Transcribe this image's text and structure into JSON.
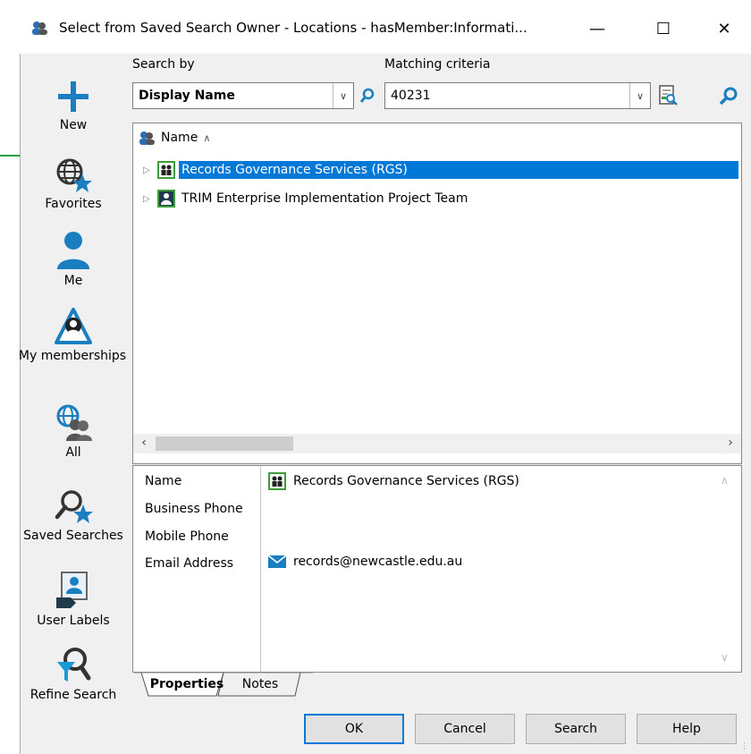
{
  "window": {
    "title": "Select from Saved Search Owner - Locations - hasMember:Informati...",
    "minimize_glyph": "—",
    "maximize_glyph": "☐",
    "close_glyph": "✕"
  },
  "sidebar": {
    "items": [
      {
        "label": "New",
        "icon": "plus-icon"
      },
      {
        "label": "Favorites",
        "icon": "globe-star-icon"
      },
      {
        "label": "Me",
        "icon": "person-icon"
      },
      {
        "label": "My memberships",
        "icon": "membership-icon"
      },
      {
        "label": "All",
        "icon": "globe-people-icon"
      },
      {
        "label": "Saved Searches",
        "icon": "search-star-icon"
      },
      {
        "label": "User Labels",
        "icon": "user-label-icon"
      },
      {
        "label": "Refine Search",
        "icon": "filter-search-icon"
      }
    ]
  },
  "search": {
    "search_by_label": "Search by",
    "search_by_value": "Display Name",
    "matching_label": "Matching criteria",
    "matching_value": "40231"
  },
  "list": {
    "column_header": "Name",
    "sort_glyph": "∧",
    "rows": [
      {
        "name": "Records Governance Services (RGS)",
        "selected": true
      },
      {
        "name": "TRIM Enterprise Implementation Project Team",
        "selected": false
      }
    ]
  },
  "properties": {
    "labels": [
      "Name",
      "Business Phone",
      "Mobile Phone",
      "Email Address"
    ],
    "name_value": "Records Governance Services (RGS)",
    "email_value": "records@newcastle.edu.au"
  },
  "tabs": [
    "Properties",
    "Notes"
  ],
  "buttons": {
    "ok": "OK",
    "cancel": "Cancel",
    "search": "Search",
    "help": "Help"
  },
  "colors": {
    "accent": "#0078d7",
    "icon_blue": "#1a7fc1",
    "annotation_arrow": "#1f9f3f"
  }
}
